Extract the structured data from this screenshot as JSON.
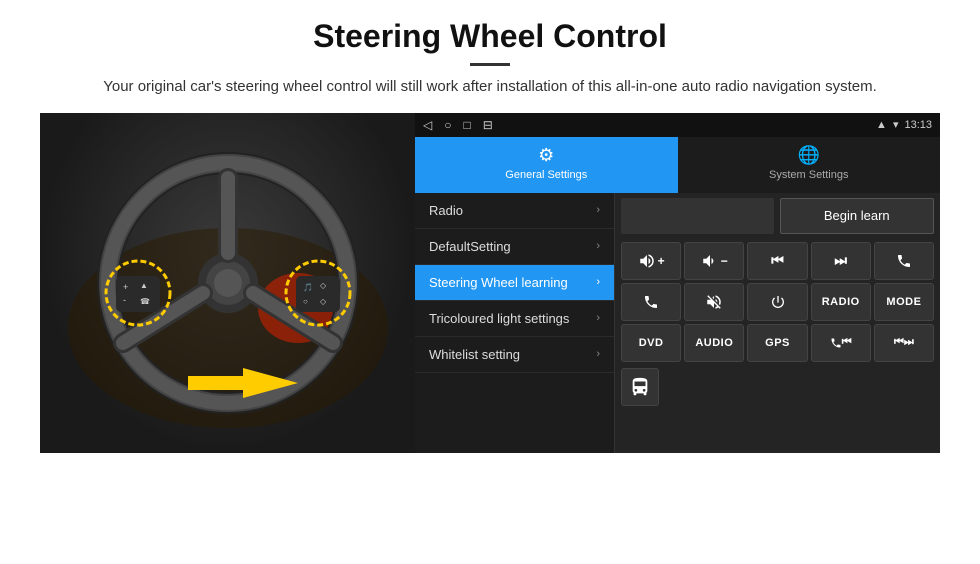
{
  "header": {
    "title": "Steering Wheel Control",
    "subtitle": "Your original car's steering wheel control will still work after installation of this all-in-one auto radio navigation system."
  },
  "statusBar": {
    "time": "13:13",
    "icons": [
      "◁",
      "○",
      "□",
      "⊟"
    ],
    "rightIcons": [
      "▲",
      "WiFi",
      "13:13"
    ]
  },
  "tabs": [
    {
      "label": "General Settings",
      "icon": "⚙",
      "active": true
    },
    {
      "label": "System Settings",
      "icon": "🌐",
      "active": false
    }
  ],
  "menuItems": [
    {
      "label": "Radio",
      "active": false
    },
    {
      "label": "DefaultSetting",
      "active": false
    },
    {
      "label": "Steering Wheel learning",
      "active": true
    },
    {
      "label": "Tricoloured light settings",
      "active": false
    },
    {
      "label": "Whitelist setting",
      "active": false
    }
  ],
  "controlPanel": {
    "beginLearnLabel": "Begin learn",
    "row1": [
      "🔊+",
      "🔊−",
      "⏮",
      "⏭",
      "📞"
    ],
    "row2": [
      "☎",
      "🔇",
      "⏻",
      "RADIO",
      "MODE"
    ],
    "row3": [
      "DVD",
      "AUDIO",
      "GPS",
      "📞⏭",
      "⏮⏭"
    ],
    "busIconLabel": "🚌"
  }
}
